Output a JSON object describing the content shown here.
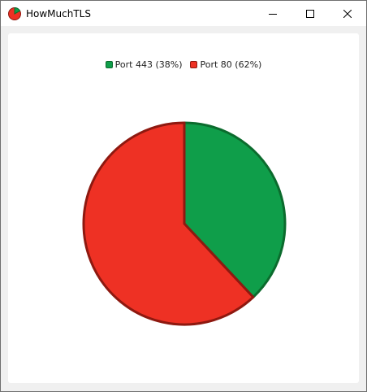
{
  "window": {
    "title": "HowMuchTLS",
    "controls": {
      "minimize": "minimize-icon",
      "maximize": "maximize-icon",
      "close": "close-icon"
    }
  },
  "chart_data": {
    "type": "pie",
    "title": "",
    "legend_position": "top-center",
    "slices": [
      {
        "label": "Port 443 (38%)",
        "value": 38,
        "color": "#0f9e4a",
        "stroke": "#0b6b2d"
      },
      {
        "label": "Port 80 (62%)",
        "value": 62,
        "color": "#ee3124",
        "stroke": "#8e1910"
      }
    ]
  }
}
